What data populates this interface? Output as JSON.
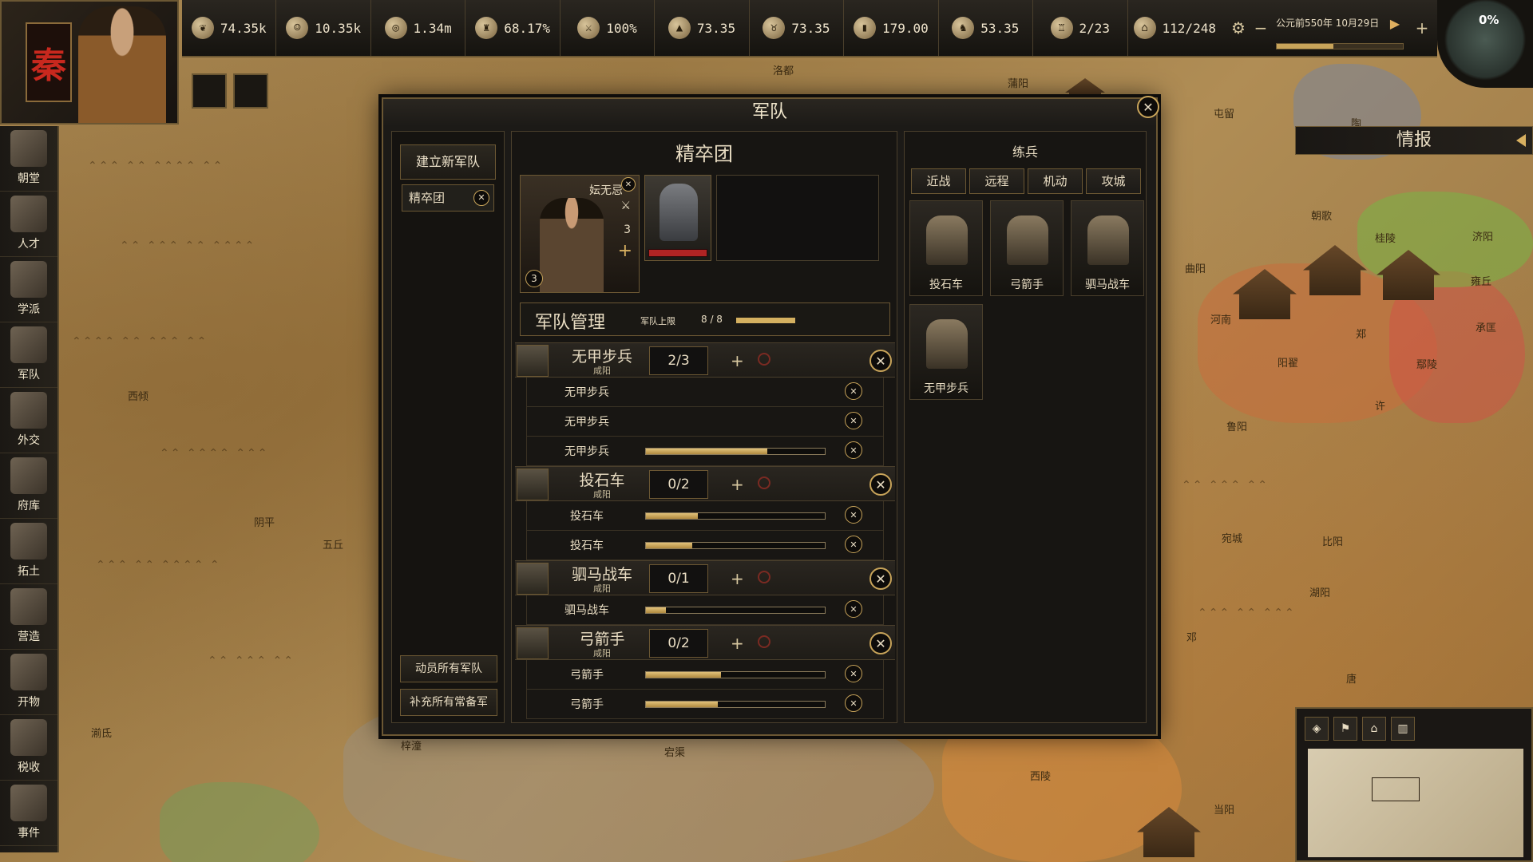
{
  "top_resources": [
    {
      "icon": "grain-icon",
      "value": "74.35k"
    },
    {
      "icon": "population-icon",
      "value": "10.35k"
    },
    {
      "icon": "coin-icon",
      "value": "1.34m"
    },
    {
      "icon": "bell-icon",
      "value": "68.17%"
    },
    {
      "icon": "crossed-swords-icon",
      "value": "100%"
    },
    {
      "icon": "hat-icon",
      "value": "73.35"
    },
    {
      "icon": "ox-icon",
      "value": "73.35"
    },
    {
      "icon": "jade-icon",
      "value": "179.00"
    },
    {
      "icon": "horse-icon",
      "value": "53.35"
    },
    {
      "icon": "fortress-icon",
      "value": "2/23"
    },
    {
      "icon": "city-icon",
      "value": "112/248"
    }
  ],
  "date": {
    "text": "公元前550年 10月29日",
    "progress": 0.45
  },
  "vessel": {
    "percent": "0%"
  },
  "ruler": {
    "seal_char": "秦"
  },
  "sidebar": {
    "items": [
      {
        "label": "朝堂",
        "icon": "court-icon"
      },
      {
        "label": "人才",
        "icon": "talent-icon"
      },
      {
        "label": "学派",
        "icon": "scroll-icon"
      },
      {
        "label": "军队",
        "icon": "army-icon"
      },
      {
        "label": "外交",
        "icon": "handshake-icon"
      },
      {
        "label": "府库",
        "icon": "treasury-icon"
      },
      {
        "label": "拓土",
        "icon": "expand-icon"
      },
      {
        "label": "营造",
        "icon": "construction-icon"
      },
      {
        "label": "开物",
        "icon": "tools-icon"
      },
      {
        "label": "税收",
        "icon": "coins-icon"
      },
      {
        "label": "事件",
        "icon": "event-icon"
      }
    ]
  },
  "dialog": {
    "title": "军队",
    "left": {
      "new_army": "建立新军队",
      "armies": [
        "精卒团"
      ],
      "mobilize_all": "动员所有军队",
      "replenish_all": "补充所有常备军"
    },
    "mid": {
      "army_name": "精卒团",
      "general": {
        "name": "妘无忌",
        "level": "3",
        "stat": "3"
      },
      "management": {
        "title": "军队管理",
        "cap_label": "军队上限",
        "cap_value": "8 / 8"
      },
      "groups": [
        {
          "name": "无甲步兵",
          "origin": "咸阳",
          "count": "2/3",
          "subs": [
            {
              "name": "无甲步兵",
              "fill": 0
            },
            {
              "name": "无甲步兵",
              "fill": 0
            },
            {
              "name": "无甲步兵",
              "fill": 0.68
            }
          ]
        },
        {
          "name": "投石车",
          "origin": "咸阳",
          "count": "0/2",
          "subs": [
            {
              "name": "投石车",
              "fill": 0.29
            },
            {
              "name": "投石车",
              "fill": 0.26
            }
          ]
        },
        {
          "name": "驷马战车",
          "origin": "咸阳",
          "count": "0/1",
          "subs": [
            {
              "name": "驷马战车",
              "fill": 0.11
            }
          ]
        },
        {
          "name": "弓箭手",
          "origin": "咸阳",
          "count": "0/2",
          "subs": [
            {
              "name": "弓箭手",
              "fill": 0.42
            },
            {
              "name": "弓箭手",
              "fill": 0.4
            }
          ]
        }
      ]
    },
    "right": {
      "title": "练兵",
      "tabs": [
        "近战",
        "远程",
        "机动",
        "攻城"
      ],
      "units": [
        "投石车",
        "弓箭手",
        "驷马战车",
        "无甲步兵"
      ]
    }
  },
  "intel": {
    "label": "情报"
  },
  "map_places": [
    "洛都",
    "蒲阳",
    "陶",
    "屯留",
    "朝歌",
    "桂陵",
    "济阳",
    "雍丘",
    "承匡",
    "鄢陵",
    "许",
    "鲁阳",
    "宛城",
    "比阳",
    "湖阳",
    "唐",
    "邓",
    "宕渠",
    "西陵",
    "当阳",
    "梓潼",
    "西倾",
    "阴平",
    "五丘",
    "湔氐",
    "阳翟",
    "河南",
    "曲阳",
    "郑"
  ],
  "minimap": {
    "buttons": [
      "compass-icon",
      "army-filter-icon",
      "city-filter-icon",
      "gate-filter-icon"
    ]
  }
}
